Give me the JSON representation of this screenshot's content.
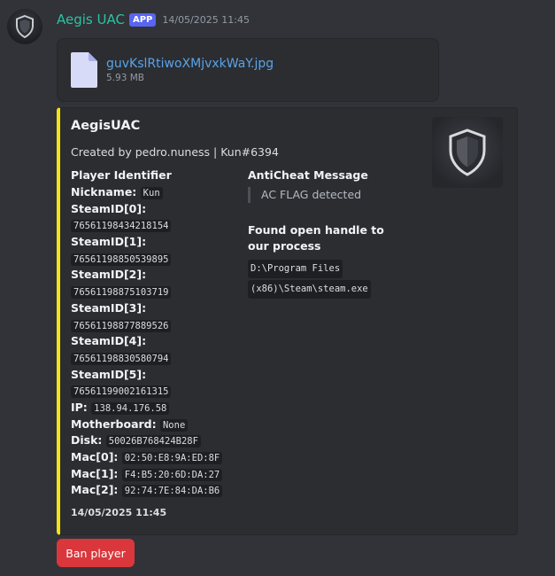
{
  "message": {
    "author": "Aegis UAC",
    "badge": "APP",
    "timestamp": "14/05/2025 11:45",
    "avatar_icon": "shield-icon"
  },
  "attachment": {
    "file_name": "guvKslRtiwoXMjvxkWaY.jpg",
    "file_size": "5.93 MB",
    "icon": "file-icon"
  },
  "embed": {
    "accent_color": "#f1e312",
    "title": "AegisUAC",
    "description": "Created by pedro.nuness | Kun#6394",
    "thumbnail_icon": "shield-icon",
    "player_identifier": {
      "title": "Player Identifier",
      "nickname_label": "Nickname:",
      "nickname": "Kun",
      "steam_ids": [
        {
          "label": "SteamID[0]:",
          "value": "76561198434218154"
        },
        {
          "label": "SteamID[1]:",
          "value": "76561198850539895"
        },
        {
          "label": "SteamID[2]:",
          "value": "76561198875103719"
        },
        {
          "label": "SteamID[3]:",
          "value": "76561198877889526"
        },
        {
          "label": "SteamID[4]:",
          "value": "76561198830580794"
        },
        {
          "label": "SteamID[5]:",
          "value": "76561199002161315"
        }
      ],
      "ip_label": "IP:",
      "ip": "138.94.176.58",
      "motherboard_label": "Motherboard:",
      "motherboard": "None",
      "disk_label": "Disk:",
      "disk": "50026B768424B28F",
      "macs": [
        {
          "label": "Mac[0]:",
          "value": "02:50:E8:9A:ED:8F"
        },
        {
          "label": "Mac[1]:",
          "value": "F4:B5:20:6D:DA:27"
        },
        {
          "label": "Mac[2]:",
          "value": "92:74:7E:84:DA:B6"
        }
      ]
    },
    "anticheat": {
      "title": "AntiCheat Message",
      "message": "AC FLAG detected",
      "handle_title": "Found open handle to our process",
      "handle_path_line1": "D:\\Program Files",
      "handle_path_line2": "(x86)\\Steam\\steam.exe"
    },
    "footer_timestamp": "14/05/2025 11:45"
  },
  "actions": {
    "ban_label": "Ban player",
    "ban_color": "#da373c"
  },
  "colors": {
    "background": "#313338",
    "embed_background": "#2b2d31",
    "author": "#2dc3a0",
    "badge": "#5865f2",
    "link": "#5aa3e8"
  }
}
